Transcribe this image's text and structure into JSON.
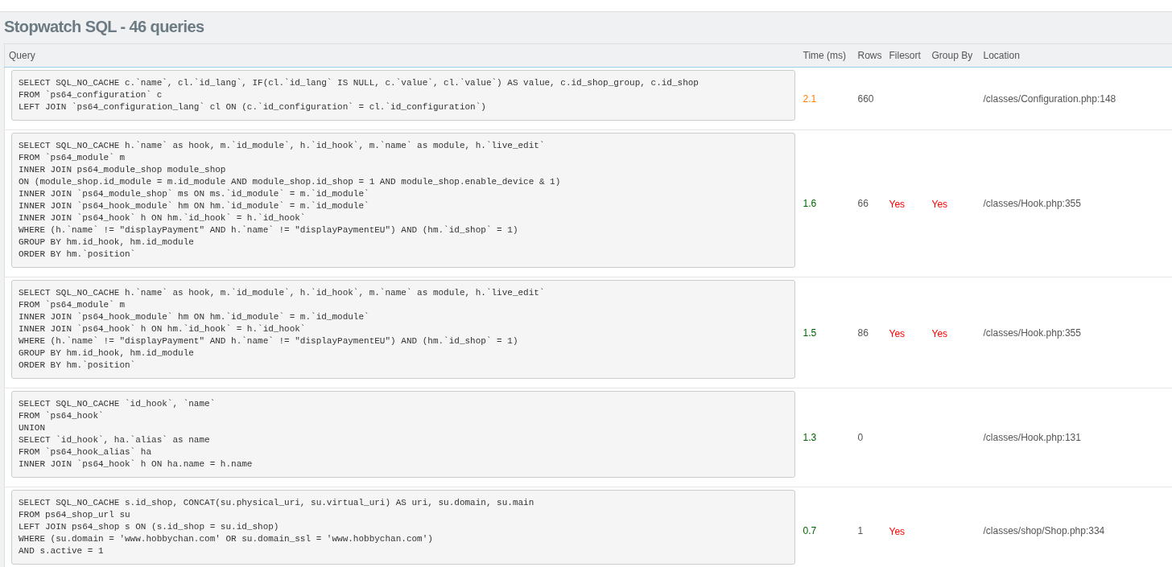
{
  "title": "Stopwatch SQL - 46 queries",
  "columns": [
    "Query",
    "Time (ms)",
    "Rows",
    "Filesort",
    "Group By",
    "Location"
  ],
  "rows": [
    {
      "query": [
        "SELECT SQL_NO_CACHE c.`name`, cl.`id_lang`, IF(cl.`id_lang` IS NULL, c.`value`, cl.`value`) AS value, c.id_shop_group, c.id_shop",
        "FROM `ps64_configuration` c",
        "LEFT JOIN `ps64_configuration_lang` cl ON (c.`id_configuration` = cl.`id_configuration`)"
      ],
      "time": "2.1",
      "color": "#ff7f00",
      "rows": "660",
      "location": "/classes/Configuration.php:148"
    },
    {
      "query": [
        "SELECT SQL_NO_CACHE h.`name` as hook, m.`id_module`, h.`id_hook`, m.`name` as module, h.`live_edit`",
        "FROM `ps64_module` m",
        "INNER JOIN ps64_module_shop module_shop",
        "ON (module_shop.id_module = m.id_module AND module_shop.id_shop = 1 AND module_shop.enable_device & 1)",
        "INNER JOIN `ps64_module_shop` ms ON ms.`id_module` = m.`id_module`",
        "INNER JOIN `ps64_hook_module` hm ON hm.`id_module` = m.`id_module`",
        "INNER JOIN `ps64_hook` h ON hm.`id_hook` = h.`id_hook`",
        "WHERE (h.`name` != \"displayPayment\" AND h.`name` != \"displayPaymentEU\") AND (hm.`id_shop` = 1)",
        "GROUP BY hm.id_hook, hm.id_module",
        "ORDER BY hm.`position`"
      ],
      "time": "1.6",
      "color": "#006400",
      "rows": "66",
      "filesort": "Yes",
      "group_by": "Yes",
      "location": "/classes/Hook.php:355"
    },
    {
      "query": [
        "SELECT SQL_NO_CACHE h.`name` as hook, m.`id_module`, h.`id_hook`, m.`name` as module, h.`live_edit`",
        "FROM `ps64_module` m",
        "INNER JOIN `ps64_hook_module` hm ON hm.`id_module` = m.`id_module`",
        "INNER JOIN `ps64_hook` h ON hm.`id_hook` = h.`id_hook`",
        "WHERE (h.`name` != \"displayPayment\" AND h.`name` != \"displayPaymentEU\") AND (hm.`id_shop` = 1)",
        "GROUP BY hm.id_hook, hm.id_module",
        "ORDER BY hm.`position`"
      ],
      "time": "1.5",
      "color": "#006400",
      "rows": "86",
      "filesort": "Yes",
      "group_by": "Yes",
      "location": "/classes/Hook.php:355"
    },
    {
      "query": [
        "SELECT SQL_NO_CACHE `id_hook`, `name`",
        "FROM `ps64_hook`",
        "UNION",
        "SELECT `id_hook`, ha.`alias` as name",
        "FROM `ps64_hook_alias` ha",
        "INNER JOIN `ps64_hook` h ON ha.name = h.name"
      ],
      "time": "1.3",
      "color": "#006400",
      "rows": "0",
      "location": "/classes/Hook.php:131"
    },
    {
      "query": [
        "SELECT SQL_NO_CACHE s.id_shop, CONCAT(su.physical_uri, su.virtual_uri) AS uri, su.domain, su.main",
        "FROM ps64_shop_url su",
        "LEFT JOIN ps64_shop s ON (s.id_shop = su.id_shop)",
        "WHERE (su.domain = 'www.hobbychan.com' OR su.domain_ssl = 'www.hobbychan.com')",
        "AND s.active = 1"
      ],
      "time": "0.7",
      "color": "#006400",
      "rows": "1",
      "filesort": "Yes",
      "location": "/classes/shop/Shop.php:334"
    }
  ]
}
